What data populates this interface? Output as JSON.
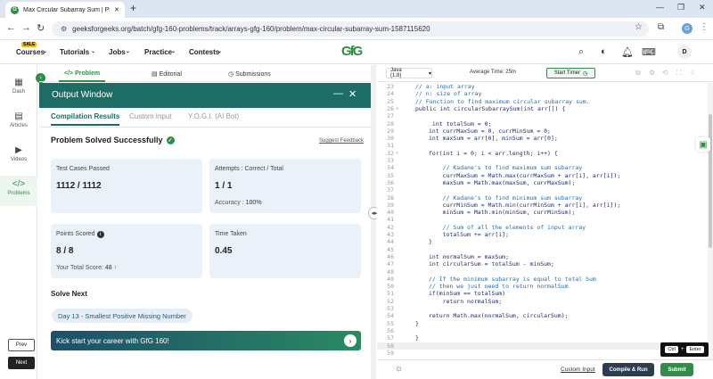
{
  "browser": {
    "tab_title": "Max Circular Subarray Sum | Pr",
    "tab_icon": "GfG",
    "url": "geeksforgeeks.org/batch/gfg-160-problems/track/arrays-gfg-160/problem/max-circular-subarray-sum-1587115620",
    "profile_initial": "G"
  },
  "site_nav": {
    "sale_badge": "SALE",
    "items": [
      "Courses",
      "Tutorials",
      "Jobs",
      "Practice",
      "Contests"
    ],
    "logo": "GfG",
    "user_initial": "D"
  },
  "sidebar": {
    "items": [
      "Dash",
      "Articles",
      "Videos",
      "Problems"
    ],
    "prev": "Prev",
    "next": "Next"
  },
  "problem_tabs": [
    "Problem",
    "Editorial",
    "Submissions"
  ],
  "output_window": {
    "title": "Output Window",
    "tabs": [
      "Compilation Results",
      "Custom Input",
      "Y.O.G.I. (AI Bot)"
    ],
    "status": "Problem Solved Successfully",
    "suggest_feedback": "Suggest Feedback",
    "cards": {
      "test_cases_label": "Test Cases Passed",
      "test_cases_value": "1112 / 1112",
      "attempts_label": "Attempts : Correct / Total",
      "attempts_value": "1 / 1",
      "accuracy_label": "Accuracy :",
      "accuracy_value": "100%",
      "points_label": "Points Scored",
      "points_value": "8 / 8",
      "total_score_label": "Your Total Score:",
      "total_score_value": "48",
      "time_label": "Time Taken",
      "time_value": "0.45"
    },
    "solve_next_heading": "Solve Next",
    "next_problem": "Day 13 - Smallest Positive Missing Number",
    "banner": "Kick start your career with GfG 160!"
  },
  "editor_toolbar": {
    "language": "Java (1.8)",
    "avg_time": "Average Time: 25m",
    "start_timer": "Start Timer"
  },
  "code": {
    "first_line": 23,
    "lines": [
      "// a: input array",
      "// n: size of array",
      "// Function to find maximum circular subarray sum.",
      "public int circularSubarraySum(int arr[]) {",
      "",
      " int totalSum = 0;",
      "int currMaxSum = 0, currMinSum = 0;",
      "int maxSum = arr[0], minSum = arr[0];",
      "",
      "for(int i = 0; i < arr.length; i++) {",
      "",
      "    // Kadane's to find maximum sum subarray",
      "    currMaxSum = Math.max(currMaxSum + arr[i], arr[i]);",
      "    maxSum = Math.max(maxSum, currMaxSum);",
      "",
      "    // Kadane's to find minimum sum subarray",
      "    currMinSum = Math.min(currMinSum + arr[i], arr[i]);",
      "    minSum = Math.min(minSum, currMinSum);",
      "",
      "    // Sum of all the elements of input array",
      "    totalSum += arr[i];",
      "}",
      "",
      "int normalSum = maxSum;",
      "int circularSum = totalSum - minSum;",
      "",
      "// If the minimum subarray is equal to total Sum",
      "// then we just need to return normalSum",
      "if(minSum == totalSum)",
      "    return normalSum;",
      "",
      "return Math.max(normalSum, circularSum);",
      "}",
      "",
      "}",
      "",
      ""
    ]
  },
  "editor_bar": {
    "custom_input": "Custom Input",
    "compile_run": "Compile & Run",
    "submit": "Submit",
    "shortcut_key1": "Ctrl",
    "shortcut_plus": "+",
    "shortcut_key2": "Enter"
  },
  "colors": {
    "brand_green": "#2f8d46",
    "output_header": "#1d6d66",
    "card_bg": "#eaf1f8"
  }
}
